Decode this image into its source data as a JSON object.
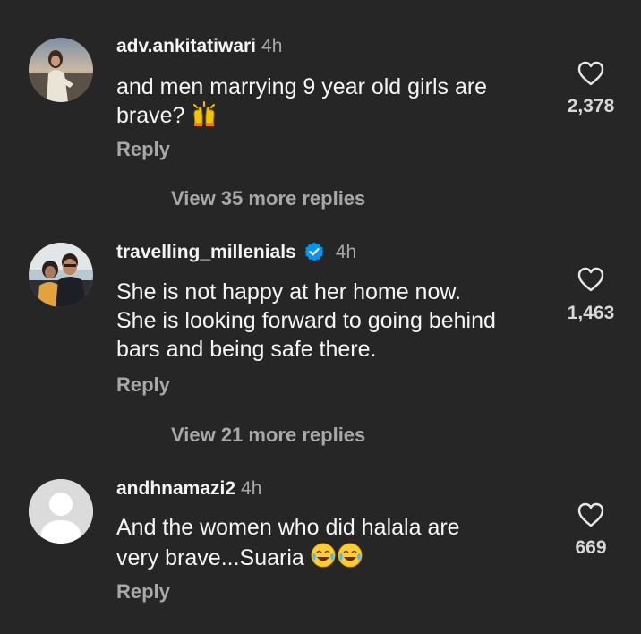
{
  "comments": [
    {
      "username": "adv.ankitatiwari",
      "time": "4h",
      "text": "and men marrying 9 year old girls are brave?",
      "emoji": "raising-hands",
      "likes": "2,378",
      "reply_label": "Reply",
      "view_more": "View 35 more replies"
    },
    {
      "username": "travelling_millenials",
      "verified": true,
      "time": "4h",
      "text_lines": [
        "She is not happy at her home now.",
        "She is looking forward to going behind",
        "bars and being safe there."
      ],
      "likes": "1,463",
      "reply_label": "Reply",
      "view_more": "View 21 more replies"
    },
    {
      "username": "andhnamazi2",
      "time": "4h",
      "text_lines": [
        "And  the women who did halala are",
        "very brave...Suaria"
      ],
      "emoji": "face-with-tears-of-joy x2",
      "likes": "669",
      "reply_label": "Reply"
    }
  ],
  "colors": {
    "background": "#262626",
    "primary_text": "#f5f5f5",
    "secondary_text": "#a8a8a8",
    "verified_blue": "#0095f6"
  }
}
